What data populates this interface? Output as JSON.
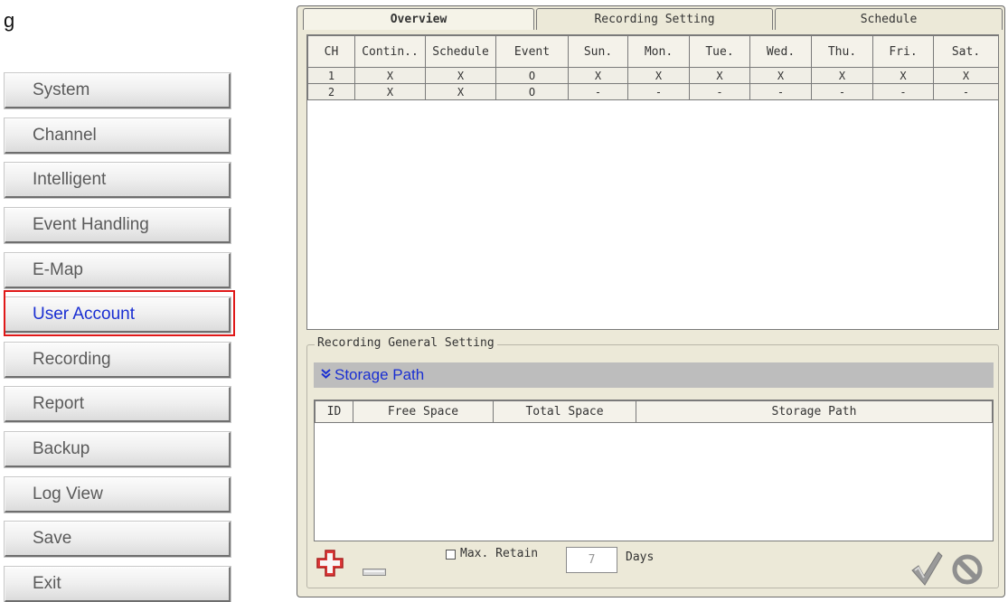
{
  "header_fragment": "g",
  "sidebar": {
    "items": [
      {
        "label": "System"
      },
      {
        "label": "Channel"
      },
      {
        "label": "Intelligent"
      },
      {
        "label": "Event Handling"
      },
      {
        "label": "E-Map"
      },
      {
        "label": "User Account",
        "active": true
      },
      {
        "label": "Recording"
      },
      {
        "label": "Report"
      },
      {
        "label": "Backup"
      },
      {
        "label": "Log View"
      },
      {
        "label": "Save"
      },
      {
        "label": "Exit"
      }
    ],
    "highlight_color": "#e01919",
    "active_text_color": "#1a2fd2"
  },
  "tabs": [
    {
      "label": "Overview",
      "active": true
    },
    {
      "label": "Recording Setting",
      "active": false
    },
    {
      "label": "Schedule",
      "active": false
    }
  ],
  "overview_table": {
    "columns": [
      "CH",
      "Contin..",
      "Schedule",
      "Event",
      "Sun.",
      "Mon.",
      "Tue.",
      "Wed.",
      "Thu.",
      "Fri.",
      "Sat."
    ],
    "rows": [
      [
        "1",
        "X",
        "X",
        "O",
        "X",
        "X",
        "X",
        "X",
        "X",
        "X",
        "X"
      ],
      [
        "2",
        "X",
        "X",
        "O",
        "-",
        "-",
        "-",
        "-",
        "-",
        "-",
        "-"
      ]
    ]
  },
  "general_setting": {
    "legend": "Recording General Setting",
    "storage_header": "Storage Path",
    "storage_columns": [
      "ID",
      "Free Space",
      "Total Space",
      "Storage Path"
    ],
    "max_retain_label": "Max. Retain",
    "max_retain_checked": false,
    "days_value": "7",
    "days_label": "Days"
  },
  "icons": {
    "add": "add-icon",
    "remove": "remove-icon",
    "ok": "checkmark-icon",
    "cancel": "cancel-icon"
  },
  "colors": {
    "panel_bg": "#ece9d8",
    "storage_header_bg": "#bdbdbd",
    "add_red": "#e23b3b"
  }
}
